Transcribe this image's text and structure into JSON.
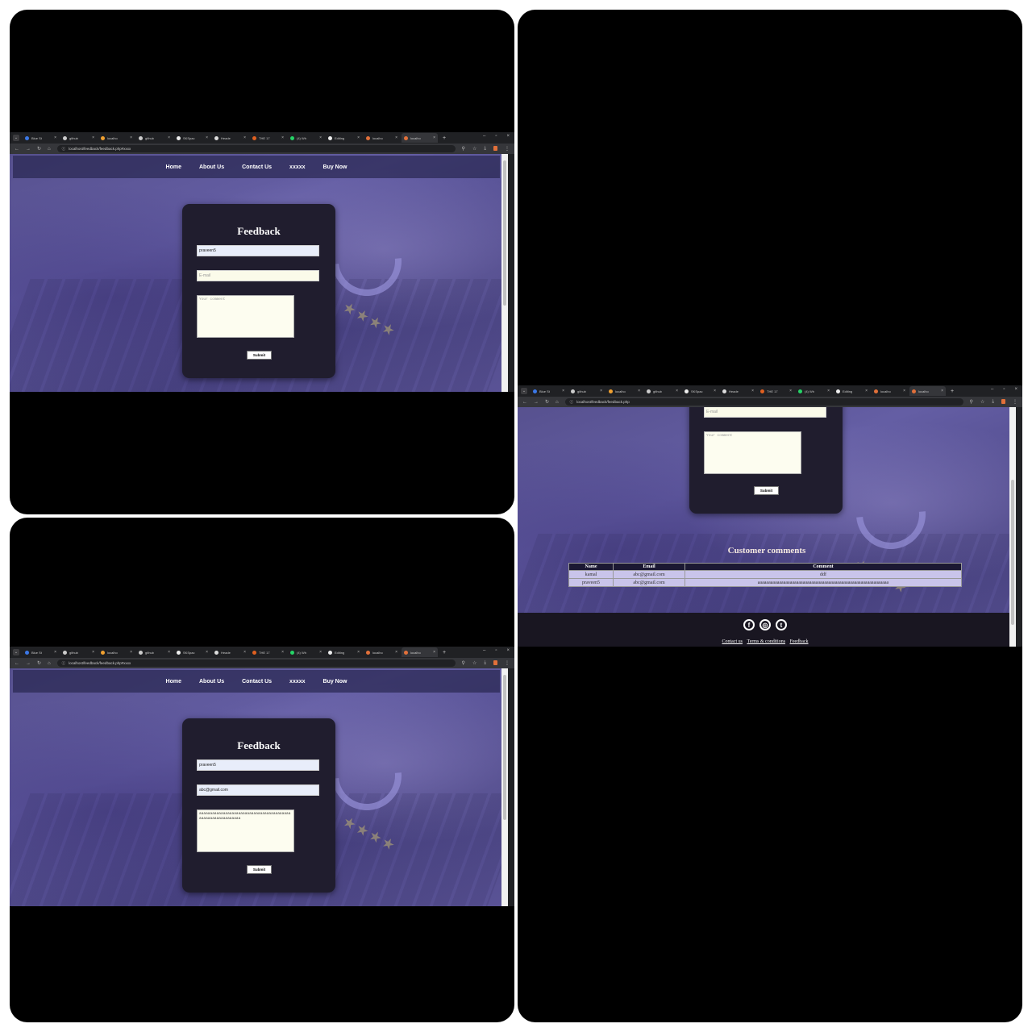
{
  "browser": {
    "tabs_a": [
      "Blue St",
      "github",
      "localho",
      "github",
      "SKSpac",
      "Heade",
      "THE 17",
      "(4) Wh",
      "Editing",
      "localho",
      "localho"
    ],
    "tabs_b": [
      "Blue St",
      "github",
      "localho",
      "github",
      "SKSpac",
      "Heade",
      "THE 17",
      "(4) Wh",
      "Editing",
      "localho",
      "localho"
    ],
    "url_form": "localhost/feedback/feedback.php#xxxx",
    "url_list": "localhost/feedback/feedback.php"
  },
  "nav": {
    "home": "Home",
    "about": "About Us",
    "contact": "Contact Us",
    "xxxxx": "xxxxx",
    "buy": "Buy Now"
  },
  "form": {
    "title": "Feedback",
    "name_value": "praveen5",
    "email_placeholder": "E-mail",
    "email_value_filled": "abc@gmail.com",
    "comment_placeholder": "Your comment",
    "comment_value_filled": "aaaaaaaaaaaaaaaaaaaaaaaaaaaaaaaaaaaaaaaaaaaaaaaaaaaaaaaaaaaaa",
    "submit": "Submit"
  },
  "comments": {
    "title": "Customer comments",
    "headers": [
      "Name",
      "Email",
      "Comment"
    ],
    "rows": [
      [
        "kamal",
        "abc@gmail.com",
        "ddf"
      ],
      [
        "praveen5",
        "abc@gmail.com",
        "aaaaaaaaaaaaaaaaaaaaaaaaaaaaaaaaaaaaaaaaaaaaaaaaaaaaaaaaaaaaa"
      ]
    ]
  },
  "footer": {
    "links": [
      "Contact us",
      "Terms & conditions",
      "Feedback"
    ]
  },
  "colors": {
    "page_bg": "#5a5396",
    "card_bg": "#201d2e",
    "nav_bg": "#28264f"
  }
}
